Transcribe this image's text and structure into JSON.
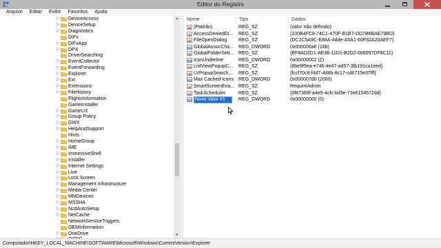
{
  "window": {
    "title": "Editor do Registro",
    "menu": [
      "Arquivo",
      "Editar",
      "Exibir",
      "Favoritos",
      "Ajuda"
    ]
  },
  "tree": {
    "items": [
      {
        "label": "DeviceAccess",
        "expander": "▷"
      },
      {
        "label": "DeviceSetup",
        "expander": "▷"
      },
      {
        "label": "Diagnostics",
        "expander": "▷"
      },
      {
        "label": "DIFx",
        "expander": ""
      },
      {
        "label": "DIFxApp",
        "expander": "▷"
      },
      {
        "label": "DPX",
        "expander": "▷"
      },
      {
        "label": "DriverSearching",
        "expander": ""
      },
      {
        "label": "EventCollector",
        "expander": "▷"
      },
      {
        "label": "EventForwarding",
        "expander": "▷"
      },
      {
        "label": "Explorer",
        "expander": "▷"
      },
      {
        "label": "Ext",
        "expander": "▷"
      },
      {
        "label": "Extensions",
        "expander": "▷"
      },
      {
        "label": "FileHistory",
        "expander": "▷"
      },
      {
        "label": "FlightsInformation",
        "expander": ""
      },
      {
        "label": "GameInstaller",
        "expander": ""
      },
      {
        "label": "GameUX",
        "expander": "▷"
      },
      {
        "label": "Group Policy",
        "expander": "▷"
      },
      {
        "label": "GWX",
        "expander": "▷"
      },
      {
        "label": "HelpAndSupport",
        "expander": "▷"
      },
      {
        "label": "Hints",
        "expander": ""
      },
      {
        "label": "HomeGroup",
        "expander": "▷"
      },
      {
        "label": "IME",
        "expander": "▷"
      },
      {
        "label": "ImmersiveShell",
        "expander": "▷"
      },
      {
        "label": "Installer",
        "expander": "▷"
      },
      {
        "label": "Internet Settings",
        "expander": "▷"
      },
      {
        "label": "Live",
        "expander": "▷"
      },
      {
        "label": "Lock Screen",
        "expander": "▷"
      },
      {
        "label": "Management Infrastructure",
        "expander": "▷"
      },
      {
        "label": "Media Center",
        "expander": "▷"
      },
      {
        "label": "MMDevices",
        "expander": "▷"
      },
      {
        "label": "MSSHA",
        "expander": "▷"
      },
      {
        "label": "NcdAutoSetup",
        "expander": "▷"
      },
      {
        "label": "NetCache",
        "expander": "▷"
      },
      {
        "label": "NetworkServiceTriggers",
        "expander": ""
      },
      {
        "label": "OEMInformation",
        "expander": ""
      },
      {
        "label": "OneDrive",
        "expander": "▷"
      },
      {
        "label": "OOBE",
        "expander": "▷"
      }
    ]
  },
  "list": {
    "headers": [
      "Nome",
      "Tipo",
      "Dados"
    ],
    "rows": [
      {
        "icon": "ab",
        "kind": "sz",
        "name": "(Padrão)",
        "type": "REG_SZ",
        "data": "(valor não definido)"
      },
      {
        "icon": "ab",
        "kind": "sz",
        "name": "AccessDeniedDi...",
        "type": "REG_SZ",
        "data": "{100B4FC8-74C1-470F-B1B7-DD7B6BAE79BD}"
      },
      {
        "icon": "ab",
        "kind": "sz",
        "name": "FileOpenDialog",
        "type": "REG_SZ",
        "data": "{DC1C5A9C-E88A-4dde-A5A1-60F82A20AEF7}"
      },
      {
        "icon": "011",
        "kind": "dword",
        "name": "GlobalAssocCha...",
        "type": "REG_DWORD",
        "data": "0x000000a6 (166)"
      },
      {
        "icon": "ab",
        "kind": "sz",
        "name": "GlobalFolderSett...",
        "type": "REG_SZ",
        "data": "{EF8AD2D1-AE36-11D1-B2D2-006097DF8C11}"
      },
      {
        "icon": "011",
        "kind": "dword",
        "name": "IconUnderline",
        "type": "REG_DWORD",
        "data": "0x00000002 (2)"
      },
      {
        "icon": "ab",
        "kind": "sz",
        "name": "ListViewPopupC...",
        "type": "REG_SZ",
        "data": "{8be9f5ea-e746-4e47-ad57-3fb191ca1eed}"
      },
      {
        "icon": "ab",
        "kind": "sz",
        "name": "LVPopupSearch...",
        "type": "REG_SZ",
        "data": "{fccf70c8-f4d7-4d8b-8c17-cd6715e37fff}"
      },
      {
        "icon": "011",
        "kind": "dword",
        "name": "Max Cached Icons",
        "type": "REG_DWORD",
        "data": "0x000007d0 (2000)"
      },
      {
        "icon": "ab",
        "kind": "sz",
        "name": "SmartScreenEna...",
        "type": "REG_SZ",
        "data": "RequireAdmin"
      },
      {
        "icon": "ab",
        "kind": "sz",
        "name": "TaskScheduler",
        "type": "REG_SZ",
        "data": "{0f87369f-a4e5-4cfc-bd3e-73e6154572dd}"
      },
      {
        "icon": "011",
        "kind": "dword",
        "name": "Novo Valor #1",
        "type": "REG_DWORD",
        "data": "0x00000000 (0)",
        "editing": true
      }
    ]
  },
  "status": {
    "path": "Computador\\HKEY_LOCAL_MACHINE\\SOFTWARE\\Microsoft\\Windows\\CurrentVersion\\Explorer"
  },
  "colors": {
    "titlebar": "#b8b8b8",
    "close_button": "#c75050",
    "selection": "#1e6fcc",
    "folder": "#e8c15a",
    "sz_icon": "#c0392b",
    "dword_icon": "#1f4fa8"
  }
}
